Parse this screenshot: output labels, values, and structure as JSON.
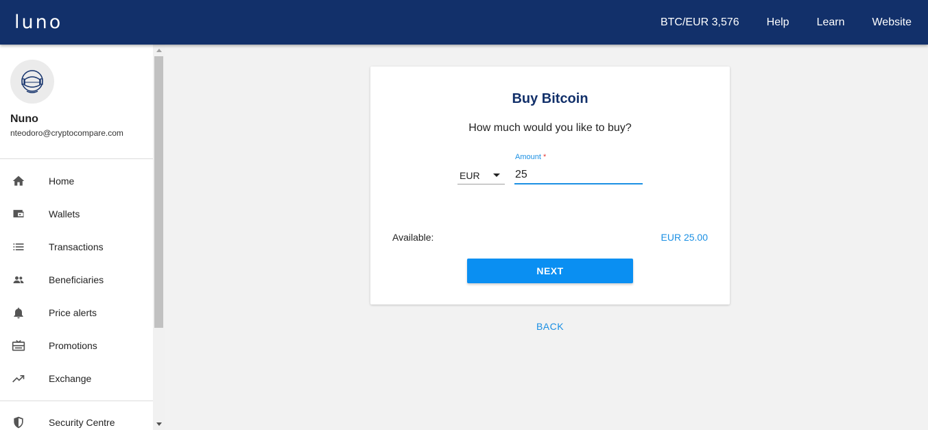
{
  "header": {
    "logo_text": "LUNO",
    "price": "BTC/EUR 3,576",
    "nav": [
      "Help",
      "Learn",
      "Website"
    ]
  },
  "user": {
    "name": "Nuno",
    "email": "nteodoro@cryptocompare.com",
    "avatar_icon": "astronaut-helmet-icon"
  },
  "sidebar": {
    "items": [
      {
        "label": "Home",
        "icon": "home-icon"
      },
      {
        "label": "Wallets",
        "icon": "wallet-icon"
      },
      {
        "label": "Transactions",
        "icon": "list-icon"
      },
      {
        "label": "Beneficiaries",
        "icon": "people-icon"
      },
      {
        "label": "Price alerts",
        "icon": "bell-icon"
      },
      {
        "label": "Promotions",
        "icon": "gift-card-icon"
      },
      {
        "label": "Exchange",
        "icon": "trending-up-icon"
      },
      {
        "label": "Security Centre",
        "icon": "shield-icon"
      }
    ]
  },
  "buy": {
    "title": "Buy Bitcoin",
    "subtitle": "How much would you like to buy?",
    "currency": "EUR",
    "amount_label": "Amount",
    "amount_required_mark": "*",
    "amount_value": "25",
    "available_label": "Available:",
    "available_value": "EUR 25.00",
    "next_label": "NEXT",
    "back_label": "BACK"
  },
  "colors": {
    "header_bg": "#12306a",
    "accent": "#1a8fe3",
    "button": "#0a8ff2",
    "page_bg": "#f2f2f2"
  }
}
